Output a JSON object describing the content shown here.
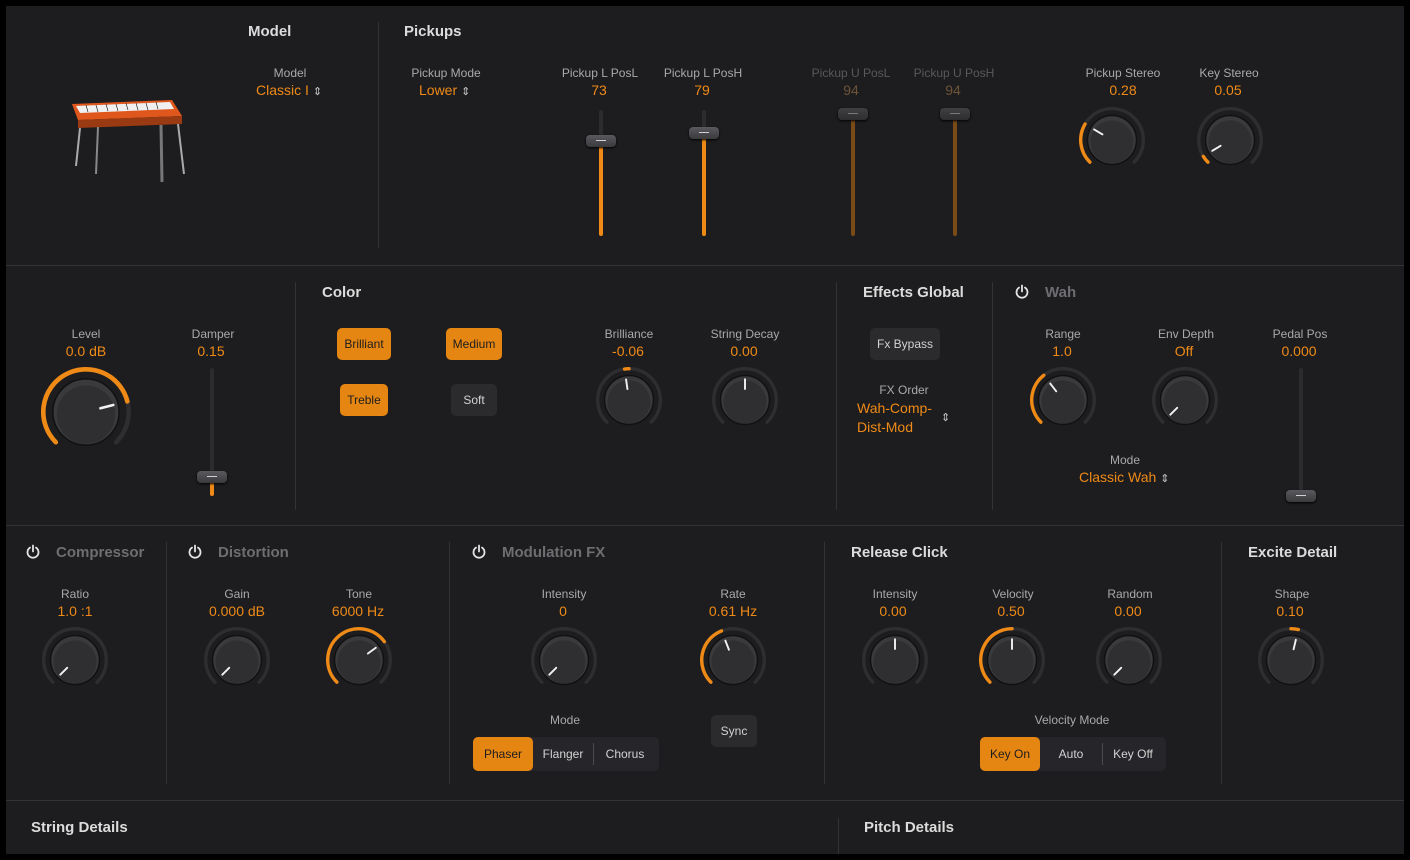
{
  "model": {
    "title": "Model",
    "label": "Model",
    "value": "Classic I"
  },
  "pickups": {
    "title": "Pickups",
    "mode_label": "Pickup Mode",
    "mode_value": "Lower",
    "l_posl_label": "Pickup L PosL",
    "l_posl_value": "73",
    "l_posh_label": "Pickup L PosH",
    "l_posh_value": "79",
    "u_posl_label": "Pickup U PosL",
    "u_posl_value": "94",
    "u_posh_label": "Pickup U PosH",
    "u_posh_value": "94",
    "stereo_label": "Pickup Stereo",
    "stereo_value": "0.28",
    "key_stereo_label": "Key Stereo",
    "key_stereo_value": "0.05"
  },
  "main": {
    "level_label": "Level",
    "level_value": "0.0 dB",
    "damper_label": "Damper",
    "damper_value": "0.15"
  },
  "color": {
    "title": "Color",
    "brilliant": "Brilliant",
    "medium": "Medium",
    "treble": "Treble",
    "soft": "Soft",
    "brilliance_label": "Brilliance",
    "brilliance_value": "-0.06",
    "decay_label": "String Decay",
    "decay_value": "0.00"
  },
  "effects_global": {
    "title": "Effects Global",
    "bypass": "Fx Bypass",
    "order_label": "FX Order",
    "order_value_line1": "Wah-Comp-",
    "order_value_line2": "Dist-Mod"
  },
  "wah": {
    "title": "Wah",
    "range_label": "Range",
    "range_value": "1.0",
    "env_label": "Env Depth",
    "env_value": "Off",
    "pedal_label": "Pedal Pos",
    "pedal_value": "0.000",
    "mode_label": "Mode",
    "mode_value": "Classic Wah"
  },
  "compressor": {
    "title": "Compressor",
    "ratio_label": "Ratio",
    "ratio_value": "1.0 :1"
  },
  "distortion": {
    "title": "Distortion",
    "gain_label": "Gain",
    "gain_value": "0.000 dB",
    "tone_label": "Tone",
    "tone_value": "6000 Hz"
  },
  "modulation": {
    "title": "Modulation FX",
    "intensity_label": "Intensity",
    "intensity_value": "0",
    "rate_label": "Rate",
    "rate_value": "0.61 Hz",
    "mode_label": "Mode",
    "modes": [
      "Phaser",
      "Flanger",
      "Chorus"
    ],
    "sync": "Sync"
  },
  "release_click": {
    "title": "Release Click",
    "intensity_label": "Intensity",
    "intensity_value": "0.00",
    "velocity_label": "Velocity",
    "velocity_value": "0.50",
    "random_label": "Random",
    "random_value": "0.00",
    "vmode_label": "Velocity Mode",
    "vmodes": [
      "Key On",
      "Auto",
      "Key Off"
    ]
  },
  "excite": {
    "title": "Excite Detail",
    "shape_label": "Shape",
    "shape_value": "0.10"
  },
  "footer": {
    "string_details": "String Details",
    "pitch_details": "Pitch Details"
  },
  "colors": {
    "accent": "#ef8a17",
    "panel": "#1d1d1f",
    "background": "#000000"
  }
}
